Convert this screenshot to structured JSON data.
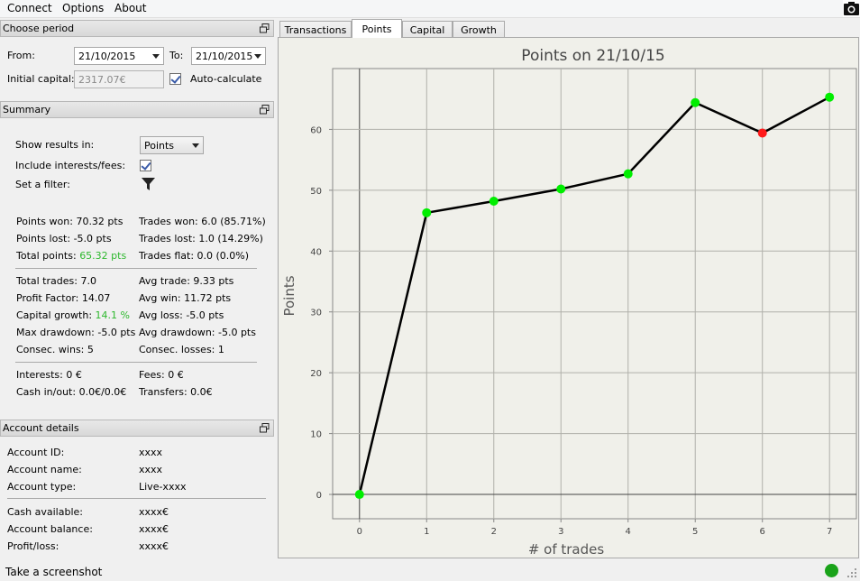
{
  "menu": {
    "connect": "Connect",
    "options": "Options",
    "about": "About"
  },
  "choose_period": {
    "title": "Choose period",
    "from_label": "From:",
    "from_value": "21/10/2015",
    "to_label": "To:",
    "to_value": "21/10/2015",
    "initial_capital_label": "Initial capital:",
    "initial_capital_value": "2317.07€",
    "auto_calculate_label": "Auto-calculate"
  },
  "summary": {
    "title": "Summary",
    "show_results_label": "Show results in:",
    "show_results_value": "Points",
    "include_interests_label": "Include interests/fees:",
    "set_filter_label": "Set a filter:",
    "points_won": "Points won: 70.32 pts",
    "trades_won": "Trades won: 6.0 (85.71%)",
    "points_lost": "Points lost: -5.0 pts",
    "trades_lost": "Trades lost: 1.0 (14.29%)",
    "total_points_label": "Total points:",
    "total_points_value": "65.32 pts",
    "trades_flat": "Trades flat: 0.0 (0.0%)",
    "total_trades": "Total trades: 7.0",
    "avg_trade": "Avg trade: 9.33 pts",
    "profit_factor": "Profit Factor: 14.07",
    "avg_win": "Avg win: 11.72 pts",
    "capital_growth_label": "Capital growth:",
    "capital_growth_value": "14.1 %",
    "avg_loss": "Avg loss: -5.0 pts",
    "max_drawdown": "Max drawdown: -5.0 pts",
    "avg_drawdown": "Avg drawdown: -5.0 pts",
    "consec_wins": "Consec. wins: 5",
    "consec_losses": "Consec. losses: 1",
    "interests": "Interests: 0 €",
    "fees": "Fees: 0 €",
    "cash_in_out": "Cash in/out: 0.0€/0.0€",
    "transfers": "Transfers: 0.0€"
  },
  "account": {
    "title": "Account details",
    "id_label": "Account ID:",
    "id_value": "xxxx",
    "name_label": "Account name:",
    "name_value": "xxxx",
    "type_label": "Account type:",
    "type_value": "Live-xxxx",
    "cash_label": "Cash available:",
    "cash_value": "xxxx€",
    "balance_label": "Account balance:",
    "balance_value": "xxxx€",
    "pl_label": "Profit/loss:",
    "pl_value": "xxxx€"
  },
  "tabs": {
    "transactions": "Transactions",
    "points": "Points",
    "capital": "Capital",
    "growth": "Growth"
  },
  "status": {
    "text": "Take a screenshot"
  },
  "colors": {
    "win_marker": "#00ee00",
    "loss_marker": "#ff1a1a",
    "line": "#000000",
    "green_text": "#2eb82e",
    "status_dot": "#1aa31a"
  },
  "chart_data": {
    "type": "line",
    "title": "Points on 21/10/15",
    "xlabel": "# of trades",
    "ylabel": "Points",
    "x": [
      0,
      1,
      2,
      3,
      4,
      5,
      6,
      7
    ],
    "y": [
      0,
      46.3,
      48.2,
      50.2,
      52.7,
      64.4,
      59.4,
      65.3
    ],
    "marker_status": [
      "win",
      "win",
      "win",
      "win",
      "win",
      "win",
      "loss",
      "win"
    ],
    "xlim": [
      -0.4,
      7.4
    ],
    "ylim": [
      -4,
      70
    ],
    "xticks": [
      0,
      1,
      2,
      3,
      4,
      5,
      6,
      7
    ],
    "yticks": [
      0,
      10,
      20,
      30,
      40,
      50,
      60
    ],
    "grid": true
  }
}
